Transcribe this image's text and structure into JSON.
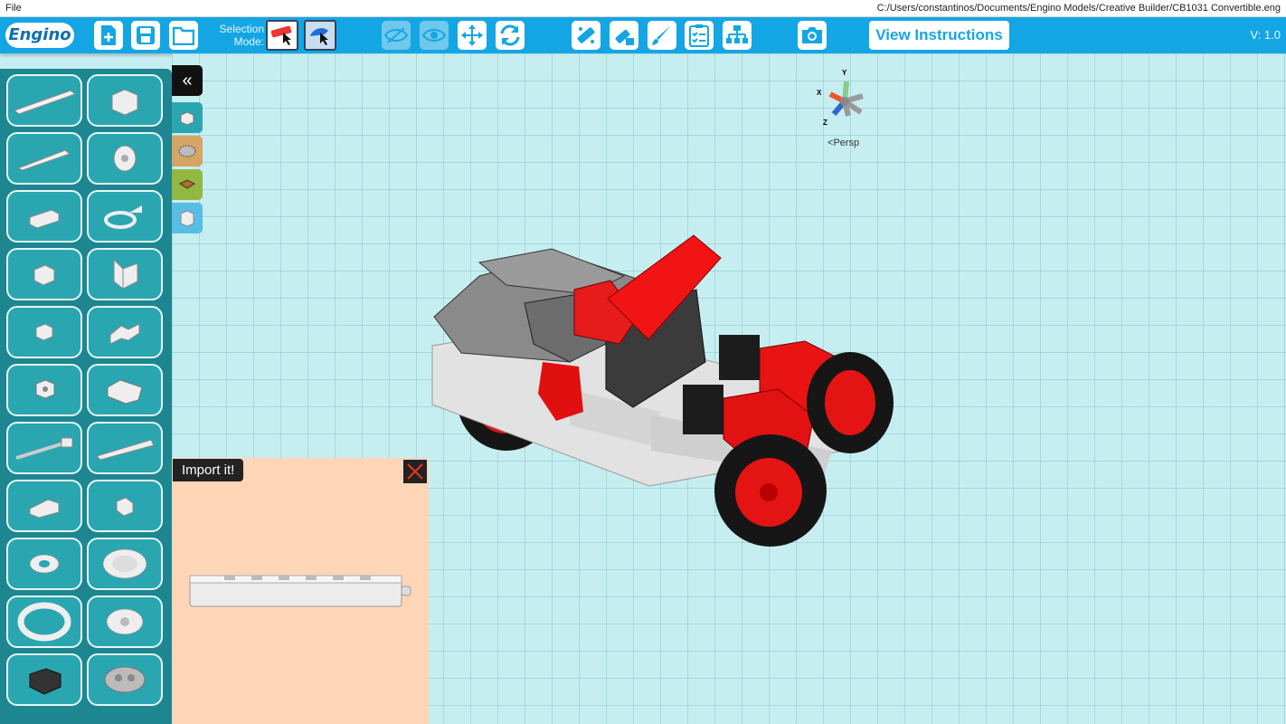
{
  "menu": {
    "file": "File",
    "path": "C:/Users/constantinos/Documents/Engino Models/Creative Builder/CB1031 Convertible.eng"
  },
  "toolbar": {
    "logo": "Engino",
    "selection_label_1": "Selection",
    "selection_label_2": "Mode:",
    "view_instructions": "View Instructions",
    "version": "V: 1.0",
    "icons": [
      "new-file-icon",
      "save-icon",
      "open-folder-icon",
      "select-part-icon",
      "select-group-icon",
      "hide-icon",
      "show-icon",
      "move-icon",
      "rotate-icon",
      "connect-icon",
      "disconnect-icon",
      "paint-icon",
      "checklist-icon",
      "hierarchy-icon",
      "camera-icon"
    ],
    "accent": "#14a6e4"
  },
  "parts_panel": {
    "items": [
      "long-beam",
      "angle-block",
      "medium-beam",
      "pulley-wheel",
      "short-beam",
      "hook-connector",
      "cube-connector",
      "hinge-plate",
      "small-connector",
      "triple-connector",
      "cross-connector",
      "double-cross-connector",
      "axle-rod",
      "rack-gear",
      "slope-block",
      "joint-connector",
      "small-gear",
      "large-gear",
      "ring-gear",
      "crown-gear",
      "motor-box",
      "gear-box"
    ],
    "bg": "#1d8690"
  },
  "categories": [
    "collapse",
    "basic-parts",
    "gears",
    "electronics",
    "storage"
  ],
  "import_panel": {
    "label": "Import it!",
    "bg": "#fed6b7"
  },
  "viewport": {
    "persp_label": "Persp",
    "axes": {
      "x": "X",
      "y": "Y",
      "z": "Z"
    }
  }
}
